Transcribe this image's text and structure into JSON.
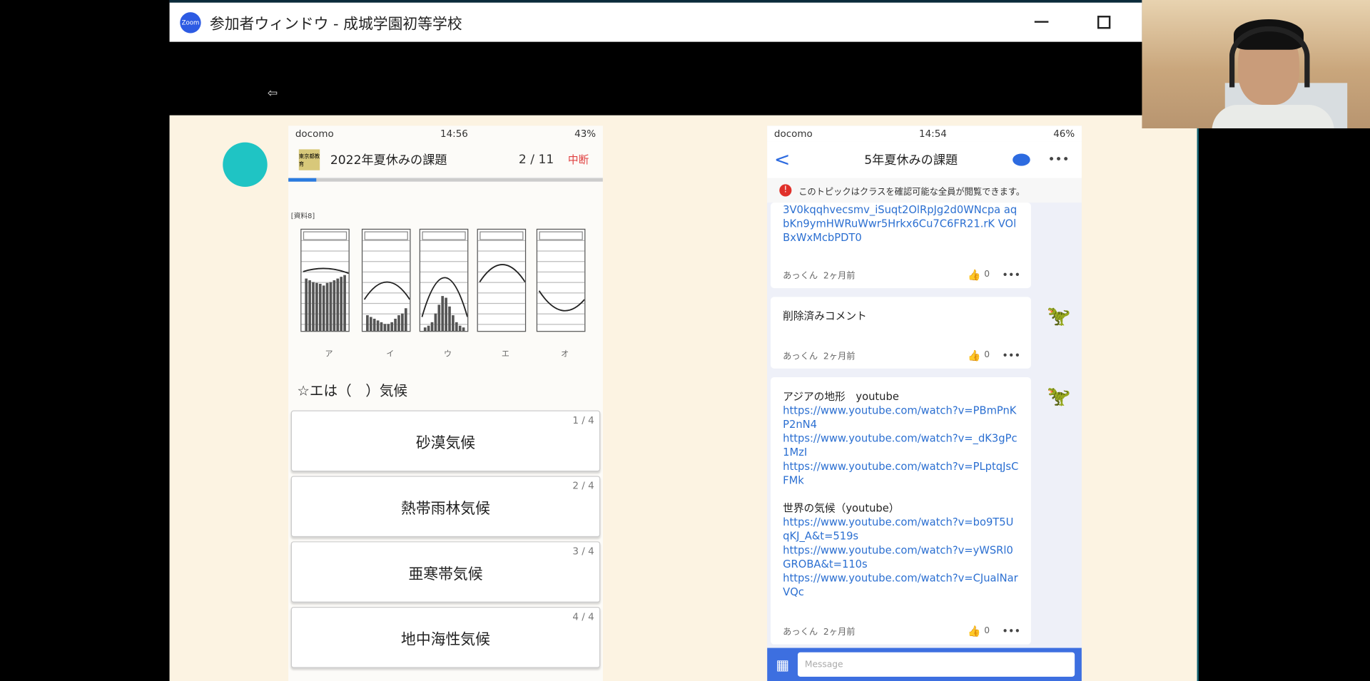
{
  "window": {
    "logo_text": "Zoom",
    "title": "参加者ウィンドウ - 成城学園初等学校",
    "back_glyph": "⇦"
  },
  "phone1": {
    "status": {
      "carrier": "docomo",
      "time": "14:56",
      "battery": "43%"
    },
    "icon_text": "東京都教育",
    "title": "2022年夏休みの課題",
    "counter": "2 / 11",
    "quit_label": "中断",
    "progress_fraction": 0.09,
    "graph_label": "[資料8]",
    "panel_letters": [
      "ア",
      "イ",
      "ウ",
      "エ",
      "オ"
    ],
    "question": "☆エは（　）気候",
    "choices": [
      {
        "index": "1 / 4",
        "label": "砂漠気候"
      },
      {
        "index": "2 / 4",
        "label": "熱帯雨林気候"
      },
      {
        "index": "3 / 4",
        "label": "亜寒帯気候"
      },
      {
        "index": "4 / 4",
        "label": "地中海性気候"
      }
    ]
  },
  "phone2": {
    "status": {
      "carrier": "docomo",
      "time": "14:54",
      "battery": "46%"
    },
    "back_glyph": "<",
    "title": "5年夏休みの課題",
    "more_glyph": "•••",
    "notice": "このトピックはクラスを確認可能な全員が閲覧できます。",
    "posts": [
      {
        "link": "3V0kqqhvecsmv_iSuqt2OlRpJg2d0WNcpa aqbKn9ymHWRuWwr5Hrkx6Cu7C6FR21.rK VOlBxWxMcbPDT0",
        "author": "あっくん",
        "time": "2ヶ月前",
        "likes": "0"
      },
      {
        "text": "削除済みコメント",
        "author": "あっくん",
        "time": "2ヶ月前",
        "likes": "0"
      },
      {
        "heading1": "アジアの地形　youtube",
        "links1": [
          "https://www.youtube.com/watch?v=PBmPnKP2nN4",
          "https://www.youtube.com/watch?v=_dK3gPc1MzI",
          "https://www.youtube.com/watch?v=PLptqJsCFMk"
        ],
        "heading2": "世界の気候（youtube）",
        "links2": [
          "https://www.youtube.com/watch?v=bo9T5UqKJ_A&t=519s",
          "https://www.youtube.com/watch?v=yWSRl0GROBA&t=110s",
          "https://www.youtube.com/watch?v=CJualNarVQc"
        ],
        "author": "あっくん",
        "time": "2ヶ月前",
        "likes": "0"
      }
    ],
    "message_placeholder": "Message"
  },
  "colors": {
    "accent": "#2d6be0",
    "share_bg": "#fcf3e2",
    "avatar_dot": "#1fc4c4",
    "quit": "#e04040"
  }
}
